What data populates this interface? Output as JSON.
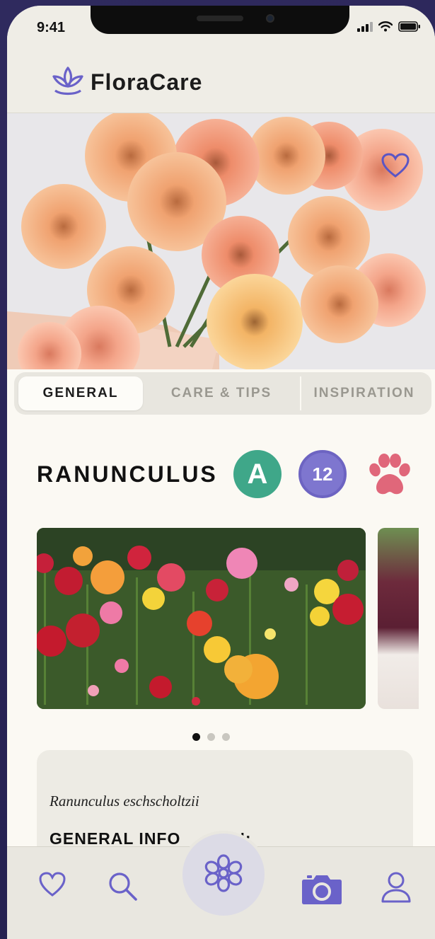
{
  "status": {
    "time": "9:41"
  },
  "app": {
    "name": "FloraCare"
  },
  "tabs": [
    {
      "label": "GENERAL",
      "active": true
    },
    {
      "label": "CARE & TIPS",
      "active": false
    },
    {
      "label": "INSPIRATION",
      "active": false
    }
  ],
  "plant": {
    "name": "RANUNCULUS",
    "grade_badge": "A",
    "count_badge": "12",
    "pet_icon": "paw-icon",
    "scientific_name": "Ranunculus eschscholtzii",
    "section_heading": "GENERAL INFO          N:"
  },
  "carousel": {
    "slide_count": 3,
    "active_index": 0
  },
  "colors": {
    "accent": "#6a62c9",
    "grade_green": "#3fa789",
    "count_purple": "#7e76cf",
    "paw_pink": "#e0677a",
    "background": "#fbf9f3"
  },
  "nav": {
    "items": [
      "heart-icon",
      "search-icon",
      "flower-icon",
      "camera-icon",
      "user-icon"
    ]
  }
}
